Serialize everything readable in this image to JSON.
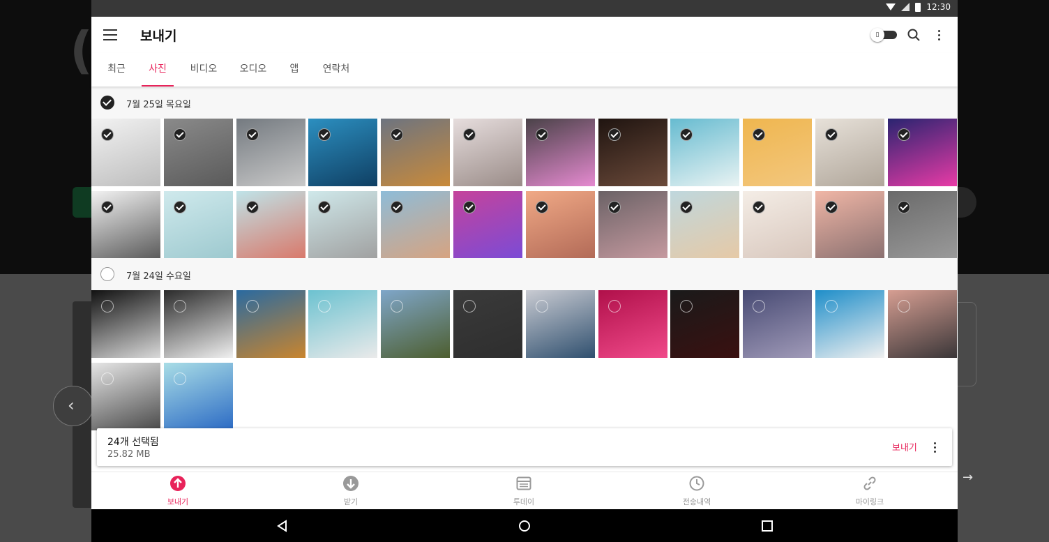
{
  "status_bar": {
    "time": "12:30"
  },
  "app_bar": {
    "title": "보내기"
  },
  "tabs": [
    {
      "label": "최근",
      "active": false
    },
    {
      "label": "사진",
      "active": true
    },
    {
      "label": "비디오",
      "active": false
    },
    {
      "label": "오디오",
      "active": false
    },
    {
      "label": "앱",
      "active": false
    },
    {
      "label": "연락처",
      "active": false
    }
  ],
  "groups": [
    {
      "date": "7월 25일 목요일",
      "selected": true,
      "photos": [
        {
          "colors": [
            "#f2f2f2",
            "#bdbdbd"
          ],
          "selected": true
        },
        {
          "colors": [
            "#8a8a8a",
            "#5a5a5a"
          ],
          "selected": true
        },
        {
          "colors": [
            "#747a80",
            "#c9c9c9"
          ],
          "selected": true
        },
        {
          "colors": [
            "#2c8fc0",
            "#0f3f63"
          ],
          "selected": true
        },
        {
          "colors": [
            "#6d7480",
            "#c98a3a"
          ],
          "selected": true
        },
        {
          "colors": [
            "#e6dddd",
            "#9a8c88"
          ],
          "selected": true
        },
        {
          "colors": [
            "#4a4248",
            "#e58ad0"
          ],
          "selected": true
        },
        {
          "colors": [
            "#1f1410",
            "#6b4a3a"
          ],
          "selected": true
        },
        {
          "colors": [
            "#66bbd0",
            "#e9f3f3"
          ],
          "selected": true
        },
        {
          "colors": [
            "#efb64f",
            "#f3c77e"
          ],
          "selected": true
        },
        {
          "colors": [
            "#e7e1d9",
            "#b0a69a"
          ],
          "selected": true
        },
        {
          "colors": [
            "#2a2470",
            "#e83ba6"
          ],
          "selected": true
        },
        {
          "colors": [
            "#f2f2f2",
            "#5a5a5a"
          ],
          "selected": true
        },
        {
          "colors": [
            "#cfe9ec",
            "#9dc9cf"
          ],
          "selected": true
        },
        {
          "colors": [
            "#bfe3e8",
            "#d9786a"
          ],
          "selected": true
        },
        {
          "colors": [
            "#cfe8ea",
            "#a0a0a0"
          ],
          "selected": true
        },
        {
          "colors": [
            "#8ebcd8",
            "#d7a380"
          ],
          "selected": true
        },
        {
          "colors": [
            "#c5439b",
            "#7b4bd6"
          ],
          "selected": true
        },
        {
          "colors": [
            "#f0a986",
            "#b26a57"
          ],
          "selected": true
        },
        {
          "colors": [
            "#6b6266",
            "#c69aa0"
          ],
          "selected": true
        },
        {
          "colors": [
            "#bfd7dd",
            "#e6c9a6"
          ],
          "selected": true
        },
        {
          "colors": [
            "#f4ede6",
            "#d8c7bd"
          ],
          "selected": true
        },
        {
          "colors": [
            "#f0b6a6",
            "#8a7070"
          ],
          "selected": true
        },
        {
          "colors": [
            "#6a6a6a",
            "#9a9a9a"
          ],
          "selected": true
        }
      ]
    },
    {
      "date": "7월 24일 수요일",
      "selected": false,
      "photos": [
        {
          "colors": [
            "#111111",
            "#d9d9d9"
          ],
          "selected": false
        },
        {
          "colors": [
            "#2b2b2b",
            "#f0f0f0"
          ],
          "selected": false
        },
        {
          "colors": [
            "#2a6aa0",
            "#c9852e"
          ],
          "selected": false
        },
        {
          "colors": [
            "#6cc2d0",
            "#eaeaea"
          ],
          "selected": false
        },
        {
          "colors": [
            "#7fa6c9",
            "#4d5e2f"
          ],
          "selected": false
        },
        {
          "colors": [
            "#3a3a3a",
            "#2e2e2e"
          ],
          "selected": false
        },
        {
          "colors": [
            "#c9cbd2",
            "#30506f"
          ],
          "selected": false
        },
        {
          "colors": [
            "#b0104a",
            "#f04a8a"
          ],
          "selected": false
        },
        {
          "colors": [
            "#1a1a1a",
            "#3a1010"
          ],
          "selected": false
        },
        {
          "colors": [
            "#474a73",
            "#a09ab8"
          ],
          "selected": false
        },
        {
          "colors": [
            "#1f8ec9",
            "#f0f0f0"
          ],
          "selected": false
        },
        {
          "colors": [
            "#d69e92",
            "#3a3638"
          ],
          "selected": false
        },
        {
          "colors": [
            "#e6e6e6",
            "#4a4a4a"
          ],
          "selected": false
        },
        {
          "colors": [
            "#a9dde6",
            "#2b6ac4"
          ],
          "selected": false
        }
      ]
    }
  ],
  "selection": {
    "count_text": "24개 선택됨",
    "size_text": "25.82 MB",
    "send_label": "보내기"
  },
  "bottom_nav": [
    {
      "label": "보내기",
      "icon": "send-icon",
      "active": true
    },
    {
      "label": "받기",
      "icon": "receive-icon",
      "active": false
    },
    {
      "label": "투데이",
      "icon": "today-icon",
      "active": false
    },
    {
      "label": "전송내역",
      "icon": "history-icon",
      "active": false
    },
    {
      "label": "마이링크",
      "icon": "link-icon",
      "active": false
    }
  ],
  "accent_color": "#e8235a"
}
